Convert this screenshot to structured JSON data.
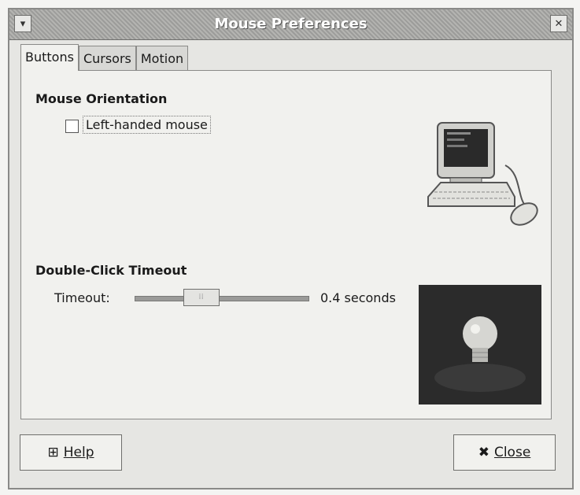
{
  "window": {
    "title": "Mouse Preferences"
  },
  "tabs": [
    {
      "label": "Buttons",
      "active": true
    },
    {
      "label": "Cursors",
      "active": false
    },
    {
      "label": "Motion",
      "active": false
    }
  ],
  "orientation": {
    "section_label": "Mouse Orientation",
    "checkbox_label": "Left-handed mouse",
    "checked": false
  },
  "double_click": {
    "section_label": "Double-Click Timeout",
    "timeout_label": "Timeout:",
    "value_text": "0.4 seconds",
    "slider_fraction": 0.35
  },
  "buttons": {
    "help_label": "Help",
    "close_label": "Close"
  },
  "icons": {
    "window_menu": "chevron-down-icon",
    "window_close": "close-icon",
    "help": "help-icon",
    "close": "x-icon",
    "computer": "computer-mouse-icon",
    "bulb": "lightbulb-icon"
  }
}
